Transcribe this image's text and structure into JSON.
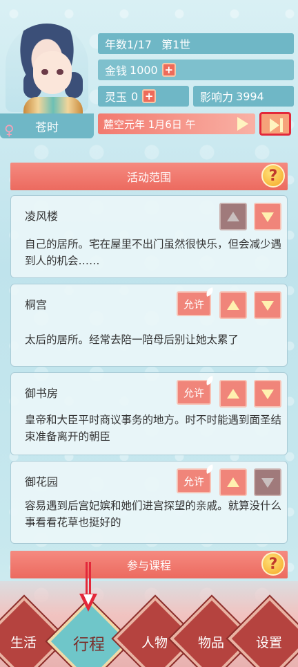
{
  "character": {
    "name": "苍时",
    "gender_icon": "female-icon"
  },
  "stats": {
    "year": "年数1/17",
    "generation": "第1世",
    "money_label": "金钱",
    "money_value": "1000",
    "jade_label": "灵玉",
    "jade_value": "0",
    "influence_label": "影响力",
    "influence_value": "3994",
    "date": "麓空元年 1月6日 午",
    "plus_label": "+"
  },
  "activity_section": {
    "title": "活动范围",
    "help": "?"
  },
  "locations": [
    {
      "name": "凌风楼",
      "desc": "自己的居所。宅在屋里不出门虽然很快乐，但会减少遇到人的机会……",
      "has_allow": false,
      "up_disabled": true,
      "down_disabled": false
    },
    {
      "name": "桐宫",
      "desc": "太后的居所。经常去陪一陪母后别让她太累了",
      "has_allow": true,
      "up_disabled": false,
      "down_disabled": false
    },
    {
      "name": "御书房",
      "desc": "皇帝和大臣平时商议事务的地方。时不时能遇到面圣结束准备离开的朝臣",
      "has_allow": true,
      "up_disabled": false,
      "down_disabled": false
    },
    {
      "name": "御花园",
      "desc": "容易遇到后宫妃嫔和她们进宫探望的亲戚。就算没什么事看看花草也挺好的",
      "has_allow": true,
      "up_disabled": false,
      "down_disabled": true
    }
  ],
  "allow_label": "允许",
  "course_section": {
    "title": "参与课程",
    "help": "?"
  },
  "tabs": [
    {
      "label": "生活",
      "active": false
    },
    {
      "label": "行程",
      "active": true
    },
    {
      "label": "人物",
      "active": false
    },
    {
      "label": "物品",
      "active": false
    },
    {
      "label": "设置",
      "active": false
    }
  ],
  "colors": {
    "accent": "#f0857a",
    "panel": "#6fb7c6",
    "highlight": "#e3283a"
  }
}
